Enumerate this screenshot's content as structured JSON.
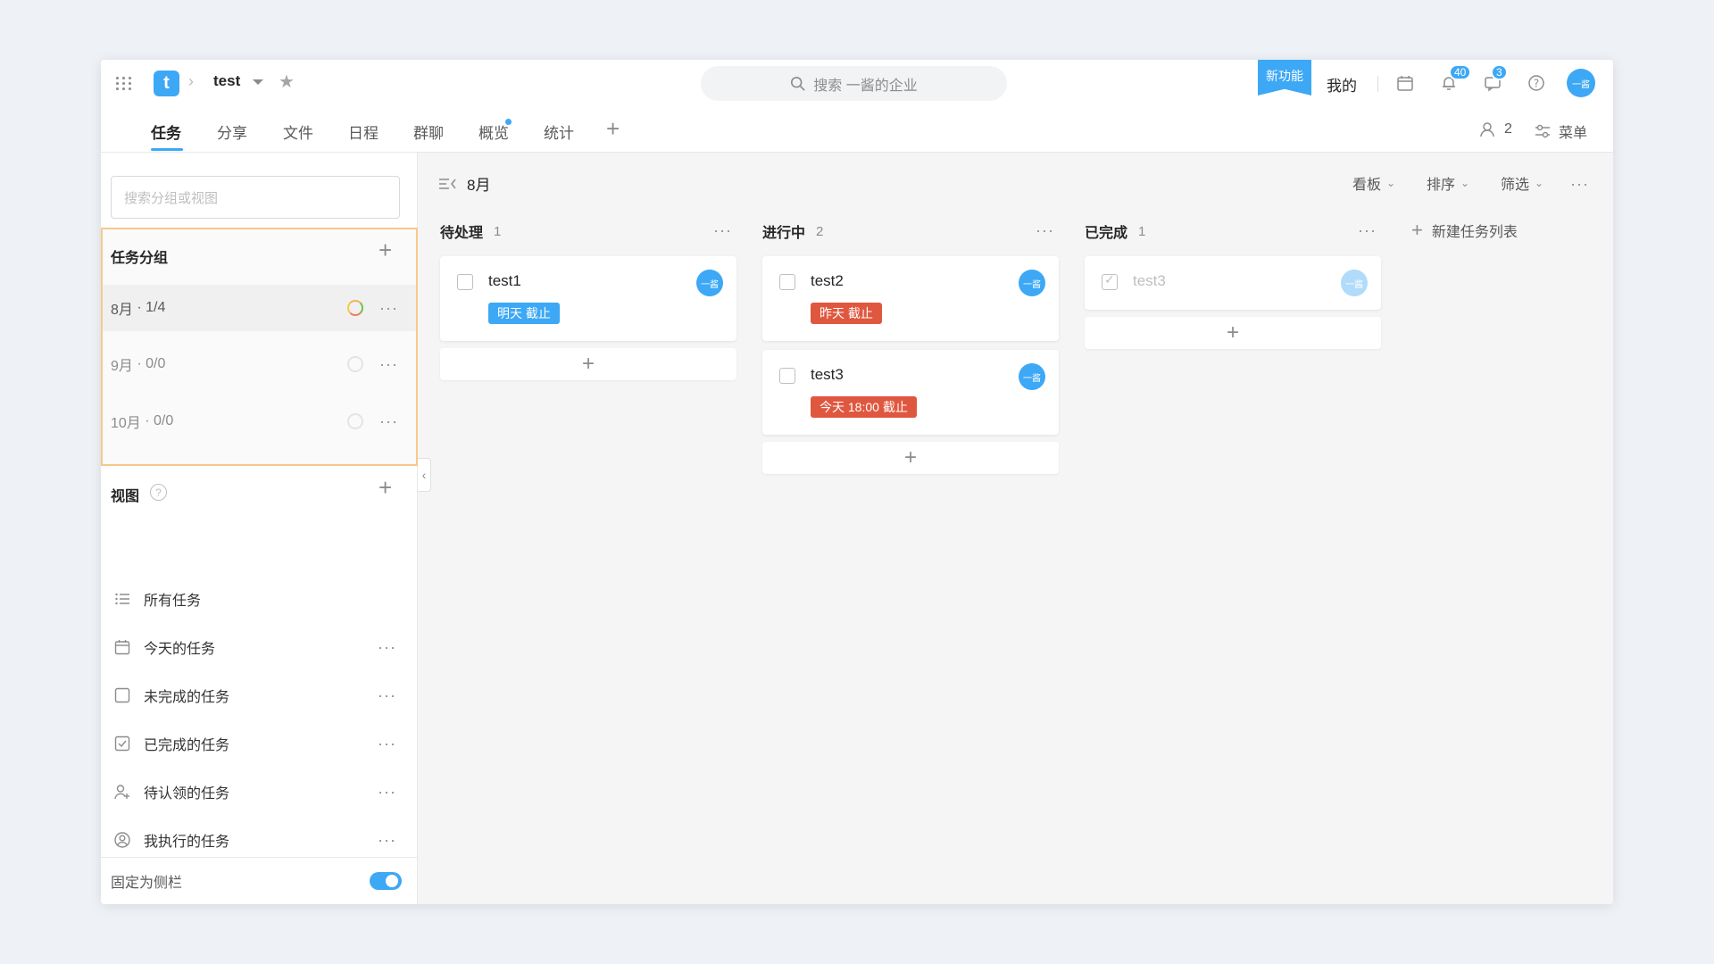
{
  "header": {
    "project_name": "test",
    "search_placeholder": "搜索 一酱的企业",
    "new_feature_label": "新功能",
    "mine_label": "我的",
    "notification_count": "40",
    "message_count": "3",
    "avatar_text": "一酱",
    "logo_letter": "t",
    "accent_color": "#3da8f5"
  },
  "tabs": [
    {
      "label": "任务"
    },
    {
      "label": "分享"
    },
    {
      "label": "文件"
    },
    {
      "label": "日程"
    },
    {
      "label": "群聊"
    },
    {
      "label": "概览"
    },
    {
      "label": "统计"
    }
  ],
  "tab_right": {
    "member_count": "2",
    "menu_label": "菜单"
  },
  "sidebar": {
    "search_placeholder": "搜索分组或视图",
    "groups_heading": "任务分组",
    "groups": [
      {
        "label": "8月",
        "progress": "1/4"
      },
      {
        "label": "9月",
        "progress": "0/0"
      },
      {
        "label": "10月",
        "progress": "0/0"
      }
    ],
    "views_heading": "视图",
    "views": [
      {
        "label": "所有任务",
        "icon": "list-icon"
      },
      {
        "label": "今天的任务",
        "icon": "calendar-icon"
      },
      {
        "label": "未完成的任务",
        "icon": "checkbox-icon"
      },
      {
        "label": "已完成的任务",
        "icon": "checkbox-checked-icon"
      },
      {
        "label": "待认领的任务",
        "icon": "user-add-icon"
      },
      {
        "label": "我执行的任务",
        "icon": "user-circle-icon"
      }
    ],
    "pin_label": "固定为侧栏",
    "pin_enabled": true
  },
  "board": {
    "title": "8月",
    "tools": {
      "kanban": "看板",
      "sort": "排序",
      "filter": "筛选"
    },
    "columns": [
      {
        "title": "待处理",
        "count": "1",
        "cards": [
          {
            "title": "test1",
            "due": "明天 截止",
            "due_color": "#3da8f5",
            "done": false
          }
        ]
      },
      {
        "title": "进行中",
        "count": "2",
        "cards": [
          {
            "title": "test2",
            "due": "昨天 截止",
            "due_color": "#e0573f",
            "done": false
          },
          {
            "title": "test3",
            "due": "今天 18:00 截止",
            "due_color": "#e0573f",
            "done": false
          }
        ]
      },
      {
        "title": "已完成",
        "count": "1",
        "cards": [
          {
            "title": "test3",
            "due": "",
            "done": true
          }
        ]
      }
    ],
    "new_list_label": "新建任务列表"
  }
}
